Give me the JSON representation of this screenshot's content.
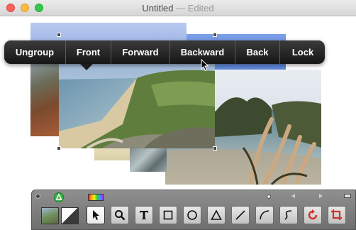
{
  "window": {
    "title": "Untitled",
    "separator": " — ",
    "state": "Edited"
  },
  "context_menu": {
    "items": [
      {
        "label": "Ungroup"
      },
      {
        "label": "Front"
      },
      {
        "label": "Forward"
      },
      {
        "label": "Backward"
      },
      {
        "label": "Back"
      },
      {
        "label": "Lock"
      }
    ]
  },
  "toolbar": {
    "tools": [
      {
        "icon": "arrow-select-icon",
        "selected": true
      },
      {
        "icon": "magnify-icon"
      },
      {
        "icon": "text-tool-icon"
      },
      {
        "icon": "rectangle-tool-icon"
      },
      {
        "icon": "circle-tool-icon"
      },
      {
        "icon": "triangle-tool-icon"
      },
      {
        "icon": "line-tool-icon"
      },
      {
        "icon": "arc-tool-icon"
      },
      {
        "icon": "curve-tool-icon"
      },
      {
        "icon": "rotate-tool-icon"
      },
      {
        "icon": "crop-tool-icon"
      }
    ],
    "accent_red": "#d0322a",
    "accent_green": "#3bb54a"
  }
}
